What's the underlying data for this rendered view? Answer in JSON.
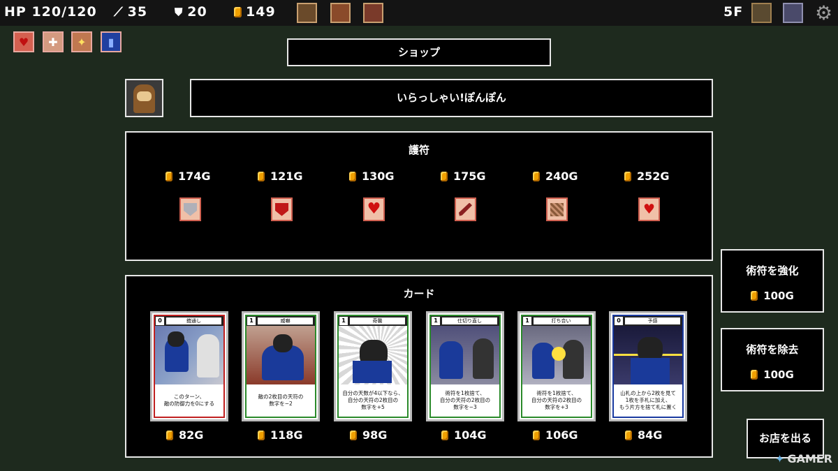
{
  "topbar": {
    "hp": "HP 120/120",
    "attack": "35",
    "defense": "20",
    "gold": "149",
    "floor": "5F"
  },
  "shop_title": "ショップ",
  "merchant": {
    "greeting": "いらっしゃい!ぽんぽん"
  },
  "charms": {
    "title": "護符",
    "items": [
      {
        "price": "174G",
        "icon": "shield-charm-icon"
      },
      {
        "price": "121G",
        "icon": "heart-shield-charm-icon"
      },
      {
        "price": "130G",
        "icon": "heart-charm-icon"
      },
      {
        "price": "175G",
        "icon": "sword-charm-icon"
      },
      {
        "price": "240G",
        "icon": "map-charm-icon"
      },
      {
        "price": "252G",
        "icon": "heart-potion-charm-icon"
      }
    ]
  },
  "cards": {
    "title": "カード",
    "items": [
      {
        "cost": "0",
        "name": "鎧通し",
        "desc": "このターン、\n敵の防御力を0にする",
        "price": "82G",
        "border": "#c02020"
      },
      {
        "cost": "1",
        "name": "威嚇",
        "desc": "敵の2枚目の天符の\n数字を−2",
        "price": "118G",
        "border": "#2a8a2a"
      },
      {
        "cost": "1",
        "name": "奇襲",
        "desc": "自分の天数が4以下なら、\n自分の天符の2枚目の\n数字を+5",
        "price": "98G",
        "border": "#2a8a2a"
      },
      {
        "cost": "1",
        "name": "仕切り直し",
        "desc": "術符を1枚捨て、\n自分の天符の2枚目の\n数字を−3",
        "price": "104G",
        "border": "#2a8a2a"
      },
      {
        "cost": "1",
        "name": "打ち合い",
        "desc": "術符を1枚捨て、\n自分の天符の2枚目の\n数字を+3",
        "price": "106G",
        "border": "#2a8a2a"
      },
      {
        "cost": "0",
        "name": "予感",
        "desc": "山札の上から2枚を見て\n1枚を手札に加え、\nもう片方を捨て札に置く",
        "price": "84G",
        "border": "#1a3aa0"
      }
    ]
  },
  "services": {
    "upgrade_label": "術符を強化",
    "upgrade_price": "100G",
    "remove_label": "術符を除去",
    "remove_price": "100G",
    "leave_label": "お店を出る"
  },
  "watermark": "GAMER",
  "colors": {
    "background": "#1e2a1e",
    "coin": "#f0a000",
    "charm_frame": "#d06050"
  }
}
